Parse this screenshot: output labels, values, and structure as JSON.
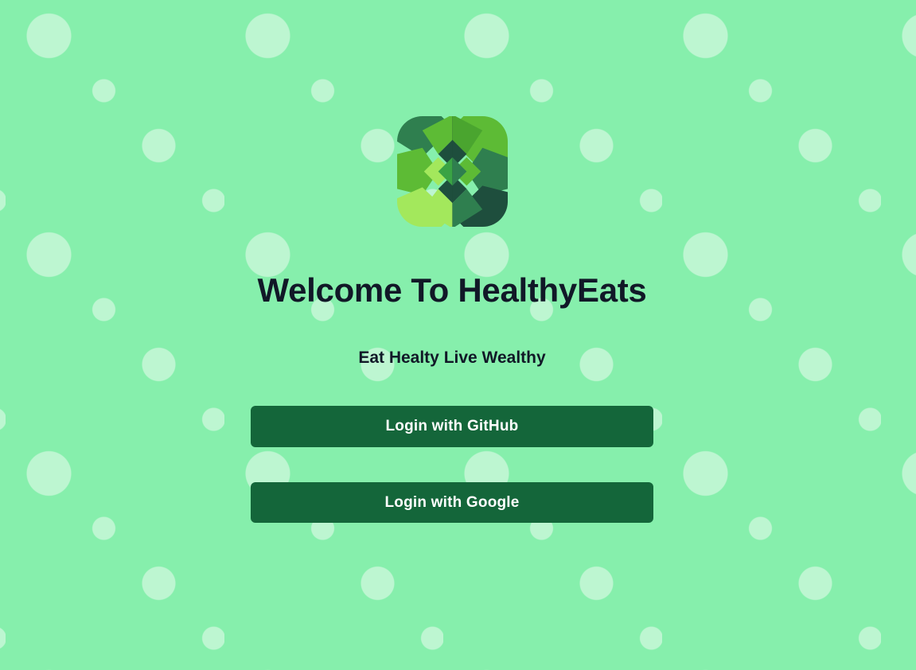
{
  "app": {
    "title": "Welcome To HealthyEats",
    "tagline": "Eat Healty Live Wealthy"
  },
  "logo": {
    "icon": "healthyeats-logo-icon",
    "colors": [
      "#2f7f4f",
      "#5dbb35",
      "#a3e85c",
      "#1e4e3d",
      "#3aa344"
    ]
  },
  "auth": {
    "github_label": "Login with GitHub",
    "google_label": "Login with Google"
  },
  "theme": {
    "background": "#86efac",
    "dots": "#bbf7d0",
    "button": "#14663a",
    "button_text": "#ffffff",
    "heading": "#111827"
  }
}
